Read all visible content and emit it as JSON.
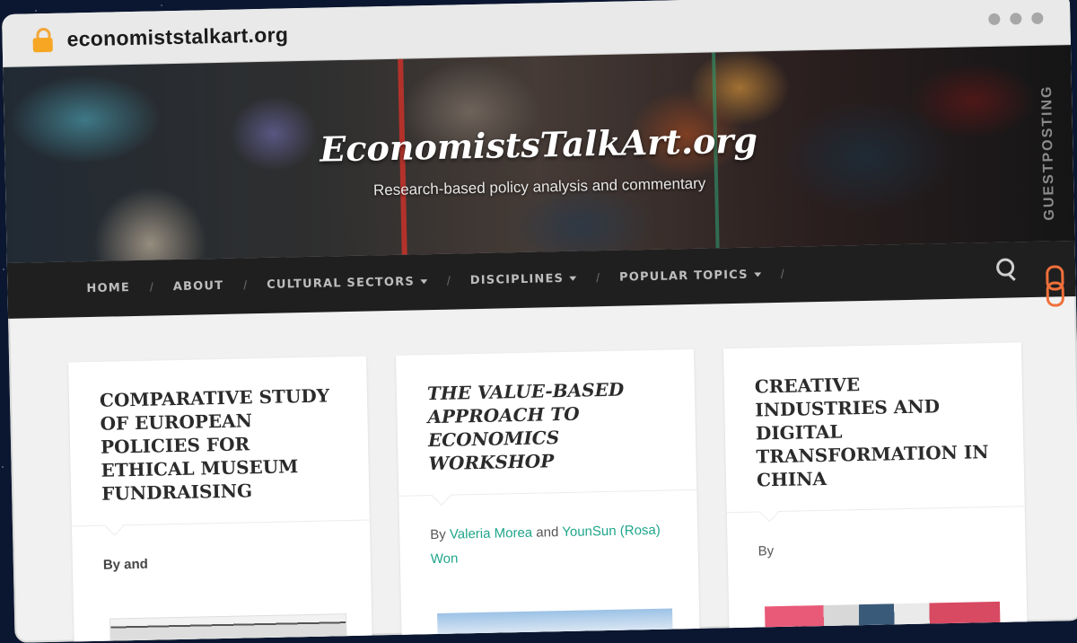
{
  "browser": {
    "url": "economiststalkart.org",
    "lock_icon": "lock-icon"
  },
  "site": {
    "title": "EconomistsTalkArt.org",
    "tagline": "Research-based policy analysis and commentary"
  },
  "nav": {
    "items": [
      {
        "label": "HOME",
        "dropdown": false
      },
      {
        "label": "ABOUT",
        "dropdown": false
      },
      {
        "label": "CULTURAL SECTORS",
        "dropdown": true
      },
      {
        "label": "DISCIPLINES",
        "dropdown": true
      },
      {
        "label": "POPULAR TOPICS",
        "dropdown": true
      }
    ],
    "separator": "/",
    "search_icon": "search-icon"
  },
  "posts": [
    {
      "title": "COMPARATIVE STUDY OF EUROPEAN POLICIES FOR ETHICAL MUSEUM FUNDRAISING",
      "by": "By and"
    },
    {
      "title": "THE VALUE-BASED APPROACH TO ECONOMICS WORKSHOP",
      "by": "By",
      "author1": "Valeria Morea",
      "and": "and",
      "author2": "YounSun (Rosa) Won"
    },
    {
      "title": "CREATIVE INDUSTRIES AND DIGITAL TRANSFORMATION IN CHINA",
      "by": "By"
    }
  ],
  "badge": {
    "text": "GUESTPOSTING",
    "accent": "#f0703a"
  },
  "colors": {
    "navbar": "#1f1f1f",
    "link": "#1fa58a",
    "lock": "#f6a623"
  }
}
